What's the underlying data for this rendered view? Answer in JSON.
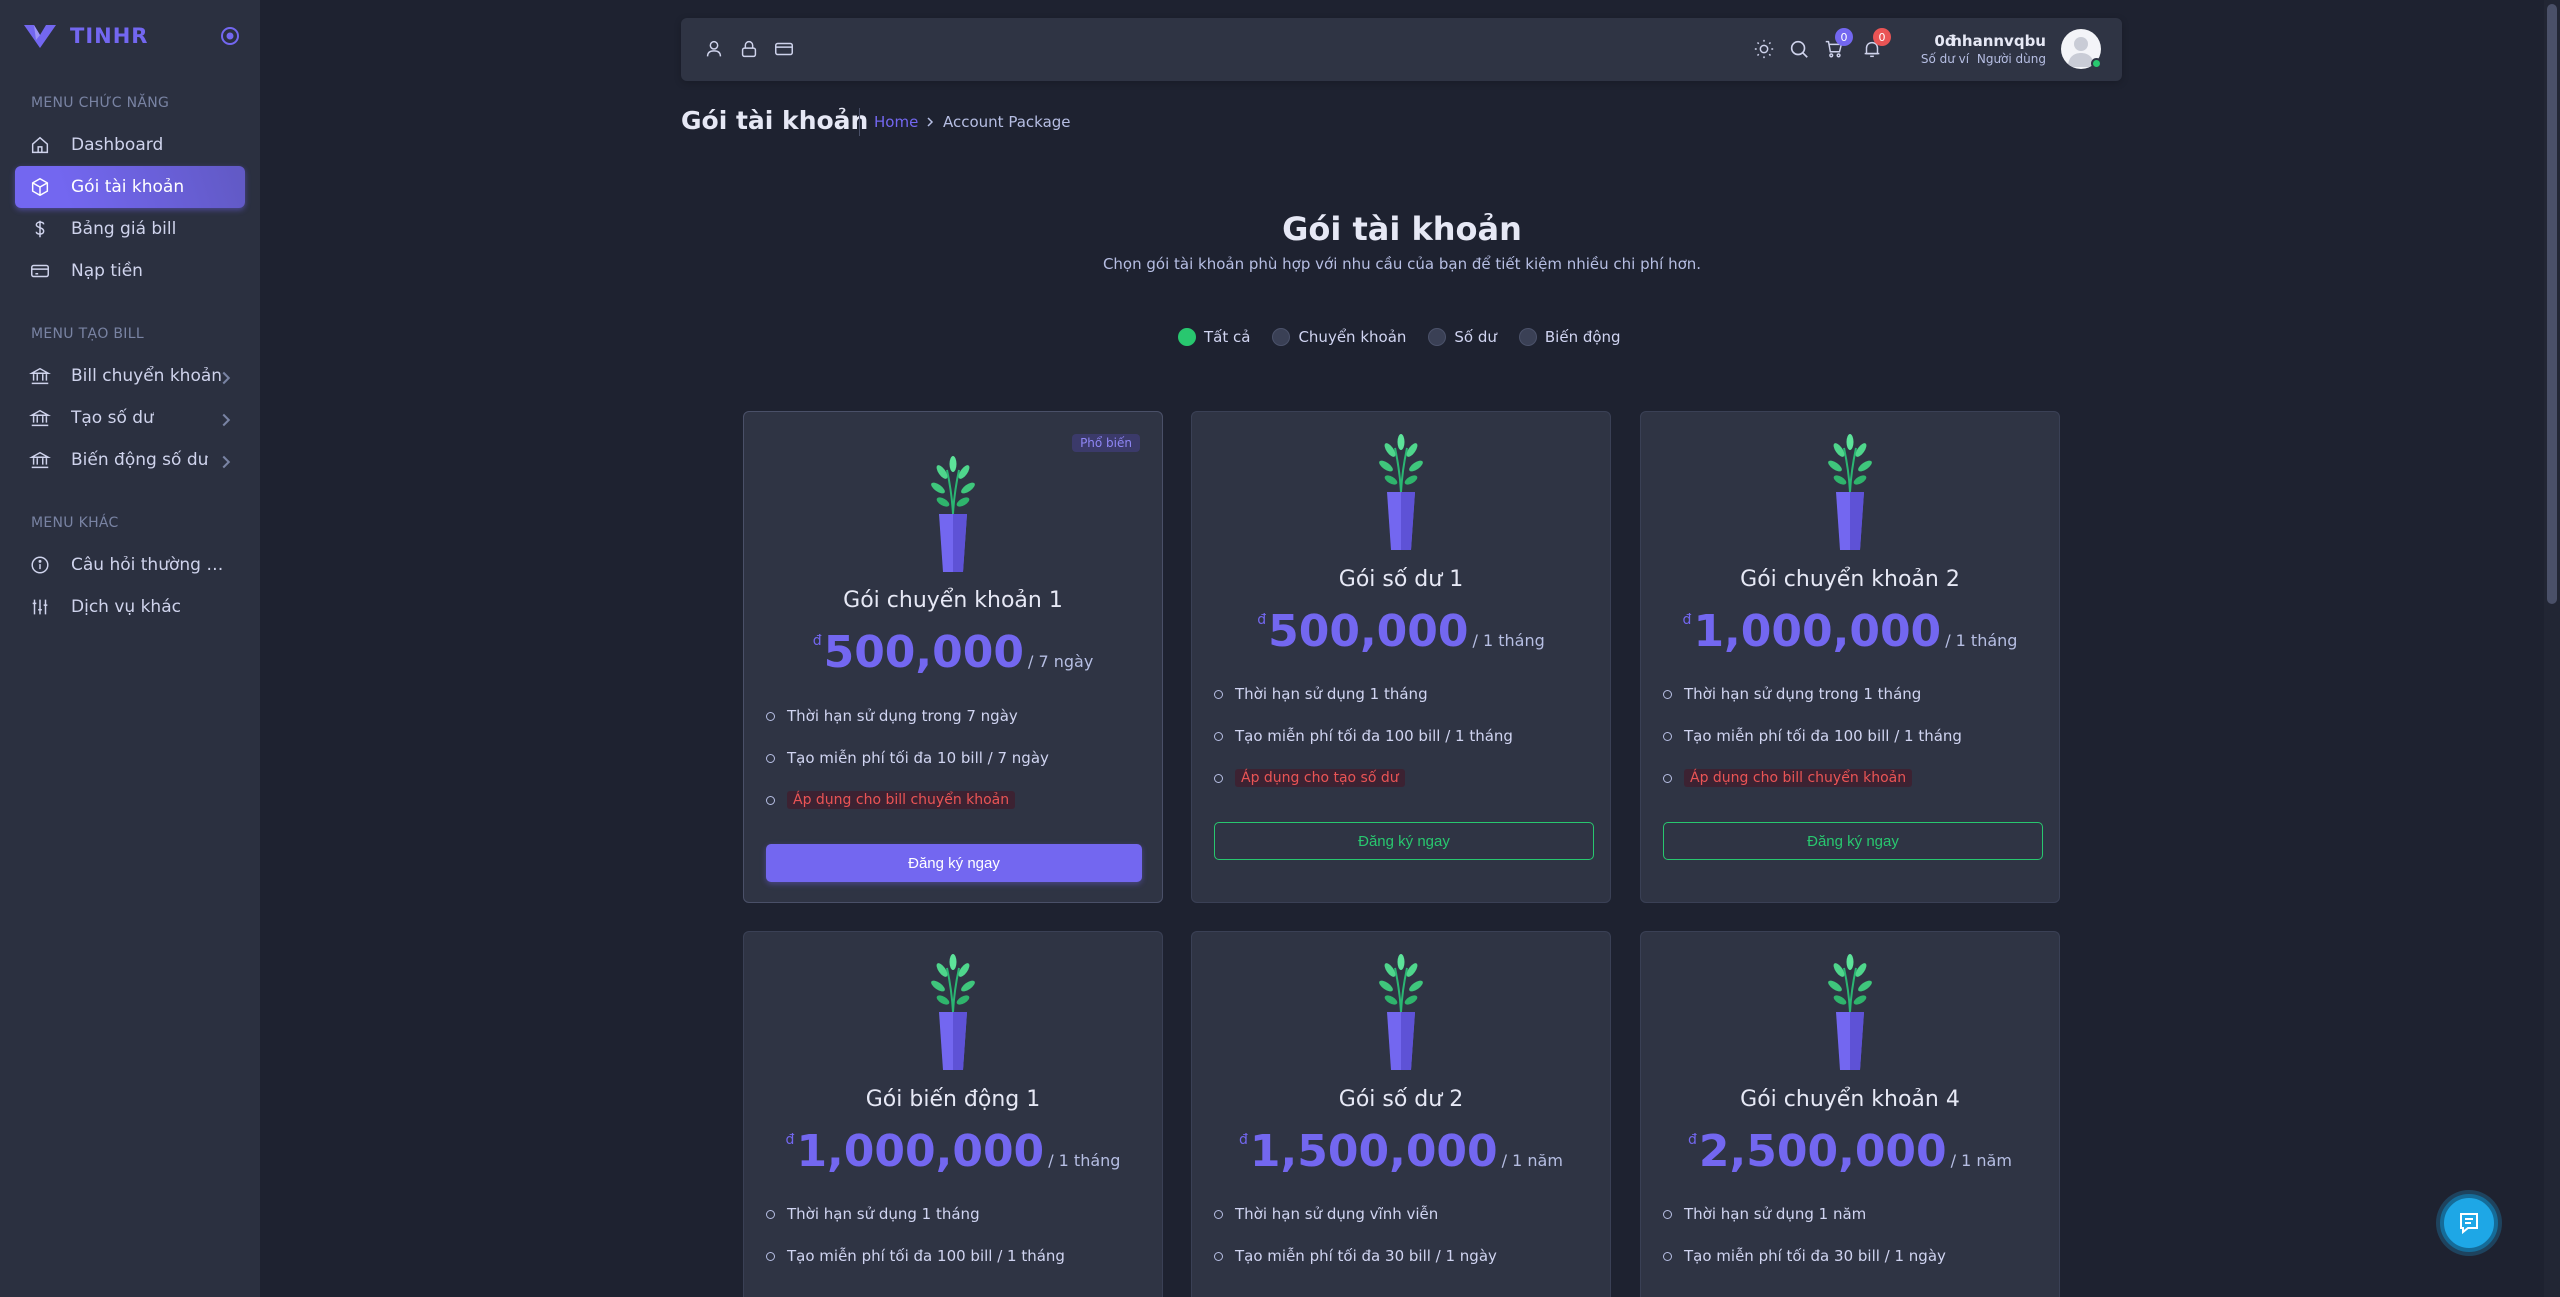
{
  "brand": {
    "name": "TINHR"
  },
  "sidebar": {
    "header_func": "MENU CHỨC NĂNG",
    "header_bill": "MENU TẠO BILL",
    "header_other": "MENU KHÁC",
    "items": [
      {
        "label": "Dashboard",
        "icon": "home-icon"
      },
      {
        "label": "Gói tài khoản",
        "icon": "package-icon",
        "active": true
      },
      {
        "label": "Bảng giá bill",
        "icon": "dollar-icon"
      },
      {
        "label": "Nạp tiền",
        "icon": "credit-card-icon"
      },
      {
        "label": "Bill chuyển khoản",
        "icon": "bank-icon"
      },
      {
        "label": "Tạo số dư",
        "icon": "bank-icon"
      },
      {
        "label": "Biến động số dư",
        "icon": "bank-icon"
      },
      {
        "label": "Câu hỏi thường gặp",
        "icon": "info-icon"
      },
      {
        "label": "Dịch vụ khác",
        "icon": "sliders-icon"
      }
    ]
  },
  "navbar": {
    "cart_count": "0",
    "notif_count": "0",
    "wallet_amount": "0đ",
    "wallet_label": "Số dư ví",
    "user_name": "nhannvqbu",
    "user_role": "Người dùng"
  },
  "page": {
    "title": "Gói tài khoản",
    "breadcrumb_home": "Home",
    "breadcrumb_current": "Account Package"
  },
  "hero": {
    "title": "Gói tài khoản",
    "subtitle": "Chọn gói tài khoản phù hợp với nhu cầu của bạn để tiết kiệm nhiều chi phí hơn."
  },
  "filters": [
    {
      "label": "Tất cả",
      "checked": true
    },
    {
      "label": "Chuyển khoản",
      "checked": false
    },
    {
      "label": "Số dư",
      "checked": false
    },
    {
      "label": "Biến động",
      "checked": false
    }
  ],
  "cards": [
    {
      "badge": "Phổ biến",
      "name": "Gói chuyển khoản 1",
      "currency": "đ",
      "price": "500,000",
      "period": "/ 7 ngày",
      "features": [
        "Thời hạn sử dụng trong 7 ngày",
        "Tạo miễn phí tối đa 10 bill / 7 ngày"
      ],
      "tag": "Áp dụng cho bill chuyển khoản",
      "button": "Đăng ký ngay"
    },
    {
      "name": "Gói số dư 1",
      "currency": "đ",
      "price": "500,000",
      "period": "/ 1 tháng",
      "features": [
        "Thời hạn sử dụng 1 tháng",
        "Tạo miễn phí tối đa 100 bill / 1 tháng"
      ],
      "tag": "Áp dụng cho tạo số dư",
      "button": "Đăng ký ngay"
    },
    {
      "name": "Gói chuyển khoản 2",
      "currency": "đ",
      "price": "1,000,000",
      "period": "/ 1 tháng",
      "features": [
        "Thời hạn sử dụng trong 1 tháng",
        "Tạo miễn phí tối đa 100 bill / 1 tháng"
      ],
      "tag": "Áp dụng cho bill chuyển khoản",
      "button": "Đăng ký ngay"
    },
    {
      "name": "Gói biến động 1",
      "currency": "đ",
      "price": "1,000,000",
      "period": "/ 1 tháng",
      "features": [
        "Thời hạn sử dụng 1 tháng",
        "Tạo miễn phí tối đa 100 bill / 1 tháng"
      ]
    },
    {
      "name": "Gói số dư 2",
      "currency": "đ",
      "price": "1,500,000",
      "period": "/ 1 năm",
      "features": [
        "Thời hạn sử dụng vĩnh viễn",
        "Tạo miễn phí tối đa 30 bill / 1 ngày"
      ]
    },
    {
      "name": "Gói chuyển khoản 4",
      "currency": "đ",
      "price": "2,500,000",
      "period": "/ 1 năm",
      "features": [
        "Thời hạn sử dụng 1 năm",
        "Tạo miễn phí tối đa 30 bill / 1 ngày"
      ]
    }
  ],
  "colors": {
    "primary": "#7367f0",
    "success": "#28c76f",
    "danger": "#ea5455",
    "bg": "#1e2230",
    "card": "#2f3444"
  }
}
